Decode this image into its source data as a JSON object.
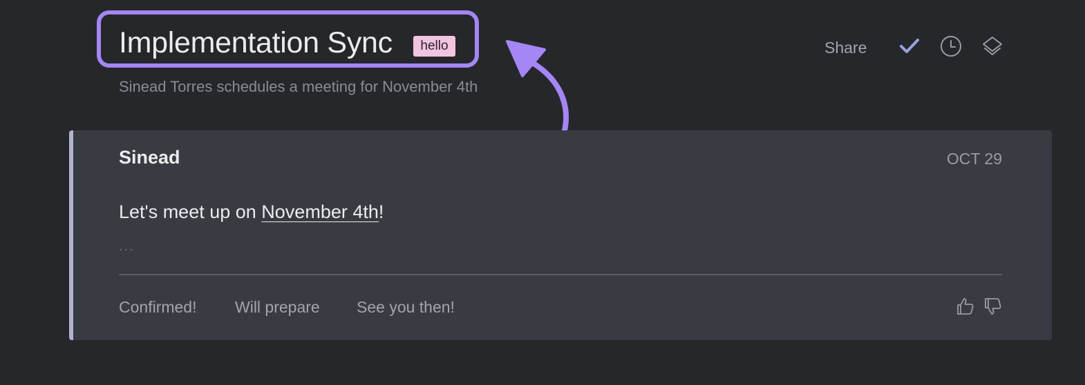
{
  "header": {
    "title": "Implementation Sync",
    "tag": "hello",
    "subtitle": "Sinead Torres schedules a meeting for November 4th",
    "share_label": "Share",
    "icons": [
      "check-icon",
      "clock-icon",
      "layers-icon"
    ]
  },
  "card": {
    "author": "Sinead",
    "date": "OCT 29",
    "message_prefix": "Let's meet up on ",
    "message_link": "November 4th",
    "message_suffix": "!",
    "ellipsis": "...",
    "quick_replies": [
      "Confirmed!",
      "Will prepare",
      "See you then!"
    ],
    "feedback_icons": [
      "thumbs-up-icon",
      "thumbs-down-icon"
    ]
  },
  "colors": {
    "background": "#26272b",
    "card": "#393b43",
    "highlight": "#a486f5",
    "tag_background": "#f2c5de",
    "card_accent_bar": "#b2b3ce",
    "check_icon": "#9aa3de"
  }
}
